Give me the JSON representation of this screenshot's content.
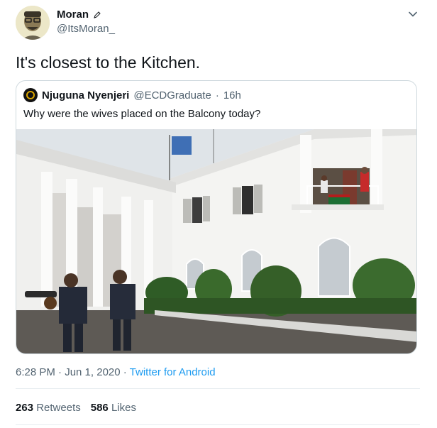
{
  "author": {
    "name": "Moran",
    "handle": "@ItsMoran_"
  },
  "tweet_text": "It's closest to the Kitchen.",
  "quoted": {
    "name": "Njuguna Nyenjeri",
    "handle": "@ECDGraduate",
    "separator": "·",
    "time": "16h",
    "text": "Why were the wives placed on the Balcony today?"
  },
  "meta": {
    "timestamp": "6:28 PM · Jun 1, 2020",
    "separator": "·",
    "source": "Twitter for Android"
  },
  "stats": {
    "retweets_count": "263",
    "retweets_label": "Retweets",
    "likes_count": "586",
    "likes_label": "Likes"
  },
  "icons": {
    "author_badge": "pen-icon",
    "menu": "chevron-down-icon"
  },
  "colors": {
    "link": "#1d9bf0",
    "secondary_text": "#536471",
    "border": "#cfd9de"
  }
}
